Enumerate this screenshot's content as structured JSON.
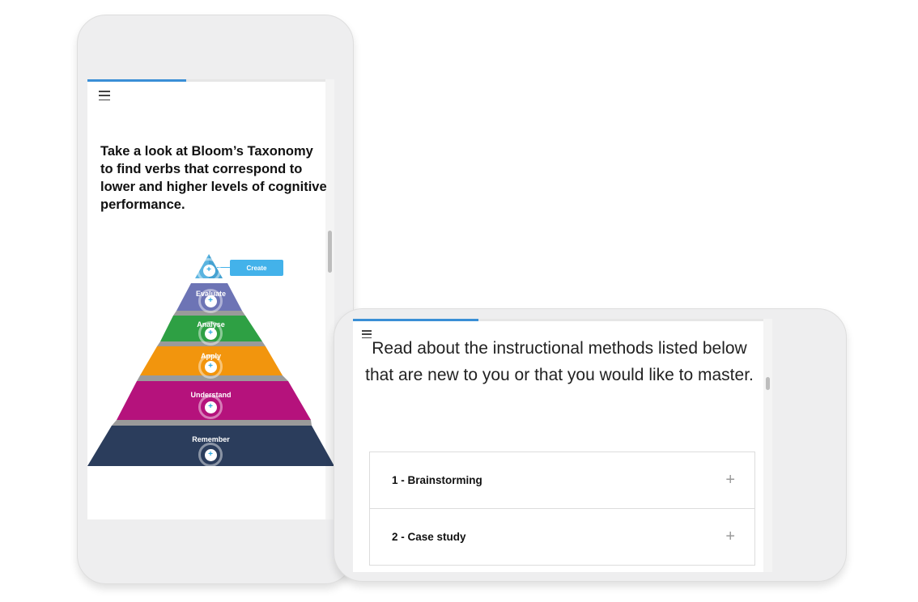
{
  "portrait": {
    "progress_percent": 40,
    "menu_icon": "hamburger-menu-icon",
    "title": "Take a look at Bloom’s Taxonomy to find verbs that correspond to lower and higher levels of cognitive performance.",
    "pyramid": {
      "callout_label": "Create",
      "levels": [
        {
          "label": "Create",
          "color": "#5ab4e0"
        },
        {
          "label": "Evaluate",
          "color": "#6d74b5"
        },
        {
          "label": "Analyse",
          "color": "#2ea044"
        },
        {
          "label": "Apply",
          "color": "#f2950d"
        },
        {
          "label": "Understand",
          "color": "#b5127c"
        },
        {
          "label": "Remember",
          "color": "#2b3d5c"
        }
      ],
      "hotspot_icon": "plus-icon",
      "hotspot_symbol": "+"
    }
  },
  "landscape": {
    "progress_percent": 30,
    "menu_icon": "hamburger-menu-icon",
    "title": "Read about the instructional methods listed below that are new to you or that you would like to master.",
    "accordion": [
      {
        "title": "1 - Brainstorming",
        "expand_symbol": "+"
      },
      {
        "title": "2 - Case study",
        "expand_symbol": "+"
      }
    ]
  },
  "colors": {
    "accent": "#3a8fd6",
    "callout": "#43b2ea",
    "device_frame": "#eeeeef"
  }
}
